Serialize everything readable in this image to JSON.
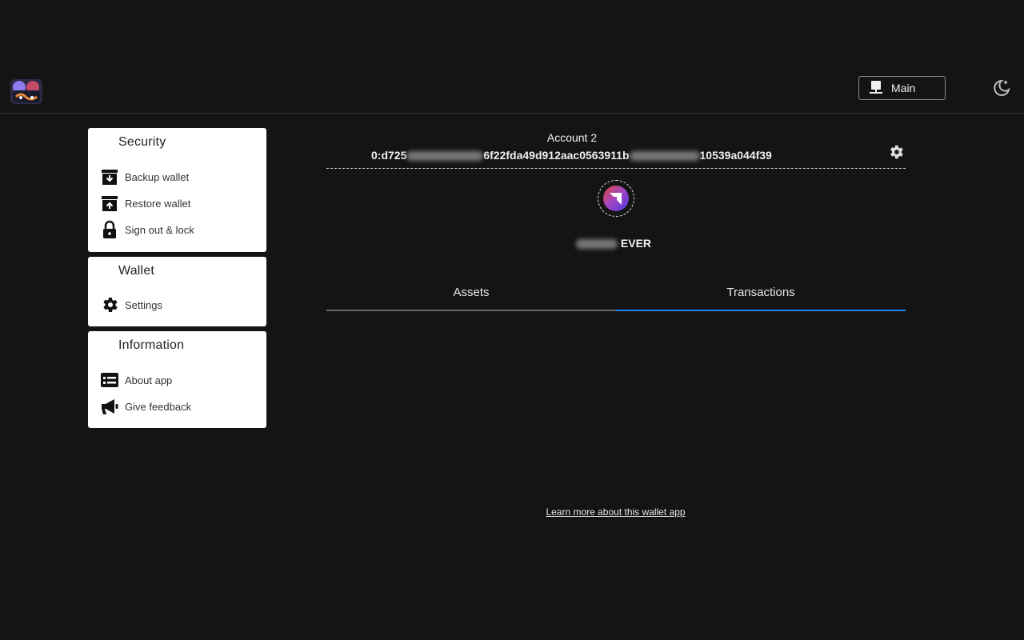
{
  "header": {
    "network_label": "Main"
  },
  "sidebar": {
    "security": {
      "title": "Security",
      "items": [
        {
          "label": "Backup wallet",
          "icon": "archive-down-icon"
        },
        {
          "label": "Restore wallet",
          "icon": "archive-up-icon"
        },
        {
          "label": "Sign out & lock",
          "icon": "lock-icon"
        }
      ]
    },
    "wallet": {
      "title": "Wallet",
      "items": [
        {
          "label": "Settings",
          "icon": "gear-icon"
        }
      ]
    },
    "information": {
      "title": "Information",
      "items": [
        {
          "label": "About app",
          "icon": "card-list-icon"
        },
        {
          "label": "Give feedback",
          "icon": "megaphone-icon"
        }
      ]
    }
  },
  "account": {
    "name": "Account 2",
    "address_prefix": "0:d725",
    "address_middle": "6f22fda49d912aac0563911b",
    "address_suffix": "10539a044f39"
  },
  "balance": {
    "currency": "EVER"
  },
  "tabs": {
    "assets": "Assets",
    "transactions": "Transactions",
    "active": "Transactions"
  },
  "footer": {
    "learn_more": "Learn more about this wallet app"
  },
  "colors": {
    "background": "#141414",
    "card": "#ffffff",
    "accent": "#1e88e5"
  }
}
